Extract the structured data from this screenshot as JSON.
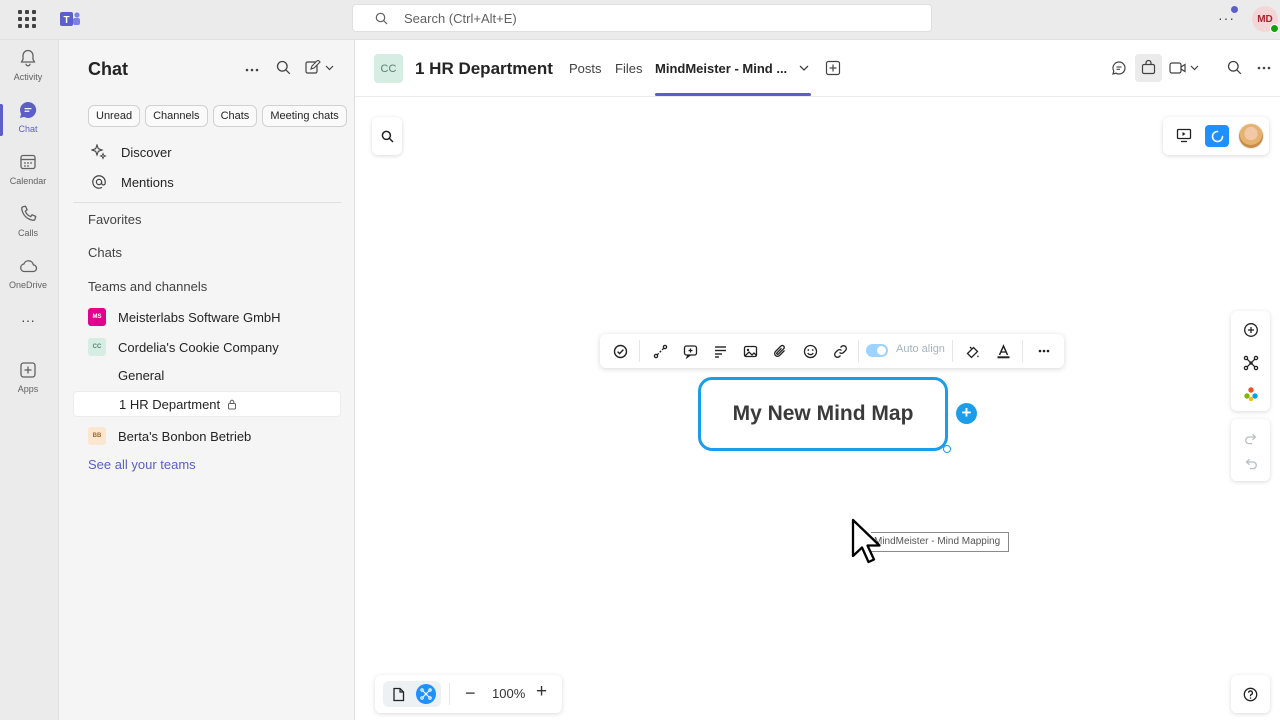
{
  "topbar": {
    "search_placeholder": "Search (Ctrl+Alt+E)",
    "more": "···",
    "user_initials": "MD"
  },
  "rail": [
    {
      "label": "Activity",
      "icon": "bell-icon"
    },
    {
      "label": "Chat",
      "icon": "chat-icon"
    },
    {
      "label": "Calendar",
      "icon": "calendar-icon"
    },
    {
      "label": "Calls",
      "icon": "phone-icon"
    },
    {
      "label": "OneDrive",
      "icon": "cloud-icon"
    },
    {
      "label": "···",
      "icon": "more-icon"
    },
    {
      "label": "Apps",
      "icon": "apps-icon"
    }
  ],
  "chatpanel": {
    "title": "Chat",
    "filters": [
      "Unread",
      "Channels",
      "Chats",
      "Meeting chats"
    ],
    "discover": "Discover",
    "mentions": "Mentions",
    "favorites": "Favorites",
    "chats": "Chats",
    "teams_and_channels": "Teams and channels",
    "teams": [
      {
        "name": "Meisterlabs Software GmbH",
        "initials": "MS",
        "color": "#e3008c",
        "text_color": "#ffffff"
      },
      {
        "name": "Cordelia's Cookie Company",
        "initials": "CC",
        "color": "#d6ede3",
        "text_color": "#5a7f70"
      },
      {
        "name": "Berta's Bonbon Betrieb",
        "initials": "BB",
        "color": "#fbe7cf",
        "text_color": "#a16a2c"
      }
    ],
    "channels": [
      "General",
      "1 HR Department"
    ],
    "see_all": "See all your teams"
  },
  "header": {
    "avatar": "CC",
    "title": "1 HR Department",
    "tabs": [
      "Posts",
      "Files",
      "MindMeister - Mind ..."
    ]
  },
  "canvas": {
    "toolbar_auto_align": "Auto align",
    "root_node": "My New Mind Map",
    "drag_label": "MindMeister - Mind Mapping",
    "zoom": "100%",
    "accent": "#1b9dea"
  }
}
